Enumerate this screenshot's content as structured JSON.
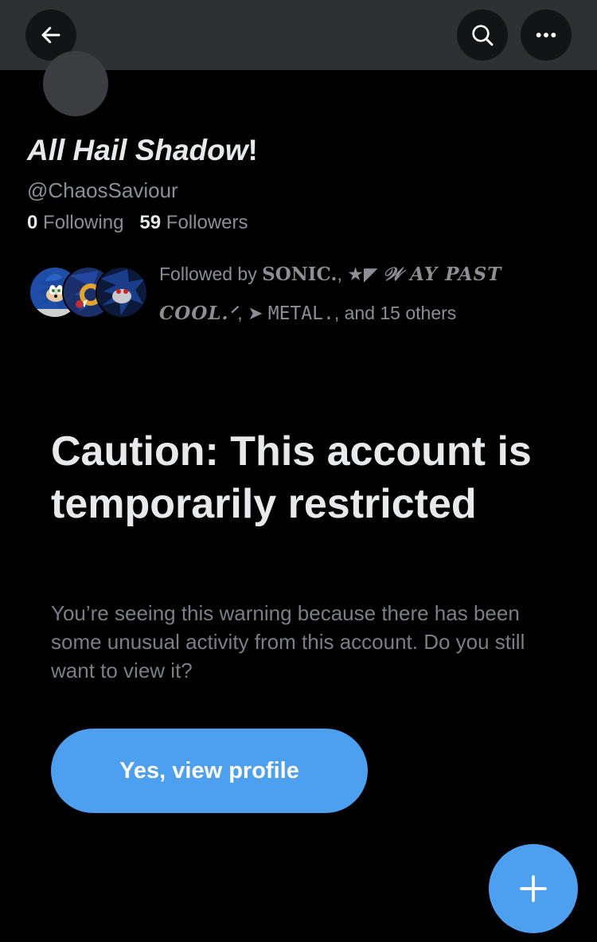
{
  "header": {
    "back_icon": "arrow-left-icon",
    "search_icon": "search-icon",
    "more_icon": "more-horizontal-icon"
  },
  "profile": {
    "display_name": "All Hail Shadow",
    "display_name_suffix": "!",
    "handle": "@ChaosSaviour",
    "following_count": "0",
    "following_label": "Following",
    "followers_count": "59",
    "followers_label": "Followers"
  },
  "followed_by": {
    "prefix": "Followed by",
    "name1": "SONIC.",
    "sep1": ",",
    "name2_symbol": "★◤",
    "name2": "𝒲 AY PAST COOL.ᐟ",
    "sep2": ",",
    "name3_symbol": "➤",
    "name3": "METAL.",
    "suffix": ", and 15 others"
  },
  "warning": {
    "title": "Caution: This account is temporarily restricted",
    "body": "You’re seeing this warning because there has been some unusual activity from this account. Do you still want to view it?",
    "button_label": "Yes, view profile"
  },
  "colors": {
    "accent": "#4d9ff0",
    "header_bg": "#2f3033",
    "background": "#000000"
  },
  "fab": {
    "icon": "plus-icon"
  }
}
